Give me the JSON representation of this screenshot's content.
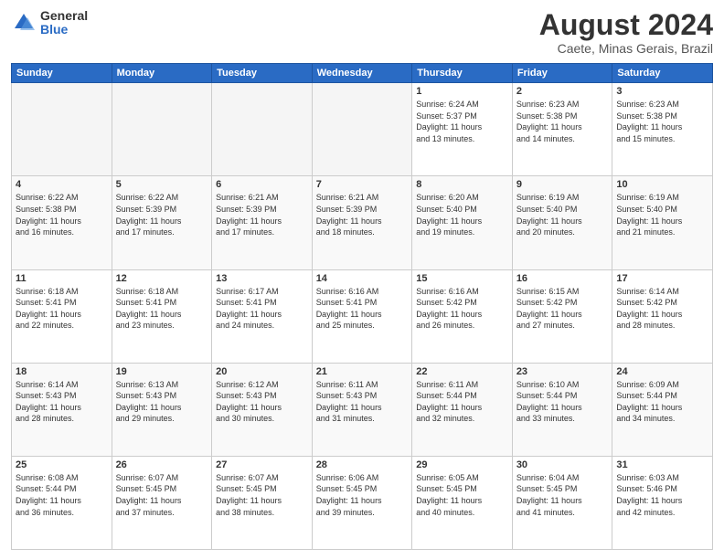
{
  "header": {
    "logo": {
      "general": "General",
      "blue": "Blue"
    },
    "title": "August 2024",
    "subtitle": "Caete, Minas Gerais, Brazil"
  },
  "calendar": {
    "days_of_week": [
      "Sunday",
      "Monday",
      "Tuesday",
      "Wednesday",
      "Thursday",
      "Friday",
      "Saturday"
    ],
    "weeks": [
      [
        {
          "day": "",
          "info": ""
        },
        {
          "day": "",
          "info": ""
        },
        {
          "day": "",
          "info": ""
        },
        {
          "day": "",
          "info": ""
        },
        {
          "day": "1",
          "info": "Sunrise: 6:24 AM\nSunset: 5:37 PM\nDaylight: 11 hours\nand 13 minutes."
        },
        {
          "day": "2",
          "info": "Sunrise: 6:23 AM\nSunset: 5:38 PM\nDaylight: 11 hours\nand 14 minutes."
        },
        {
          "day": "3",
          "info": "Sunrise: 6:23 AM\nSunset: 5:38 PM\nDaylight: 11 hours\nand 15 minutes."
        }
      ],
      [
        {
          "day": "4",
          "info": "Sunrise: 6:22 AM\nSunset: 5:38 PM\nDaylight: 11 hours\nand 16 minutes."
        },
        {
          "day": "5",
          "info": "Sunrise: 6:22 AM\nSunset: 5:39 PM\nDaylight: 11 hours\nand 17 minutes."
        },
        {
          "day": "6",
          "info": "Sunrise: 6:21 AM\nSunset: 5:39 PM\nDaylight: 11 hours\nand 17 minutes."
        },
        {
          "day": "7",
          "info": "Sunrise: 6:21 AM\nSunset: 5:39 PM\nDaylight: 11 hours\nand 18 minutes."
        },
        {
          "day": "8",
          "info": "Sunrise: 6:20 AM\nSunset: 5:40 PM\nDaylight: 11 hours\nand 19 minutes."
        },
        {
          "day": "9",
          "info": "Sunrise: 6:19 AM\nSunset: 5:40 PM\nDaylight: 11 hours\nand 20 minutes."
        },
        {
          "day": "10",
          "info": "Sunrise: 6:19 AM\nSunset: 5:40 PM\nDaylight: 11 hours\nand 21 minutes."
        }
      ],
      [
        {
          "day": "11",
          "info": "Sunrise: 6:18 AM\nSunset: 5:41 PM\nDaylight: 11 hours\nand 22 minutes."
        },
        {
          "day": "12",
          "info": "Sunrise: 6:18 AM\nSunset: 5:41 PM\nDaylight: 11 hours\nand 23 minutes."
        },
        {
          "day": "13",
          "info": "Sunrise: 6:17 AM\nSunset: 5:41 PM\nDaylight: 11 hours\nand 24 minutes."
        },
        {
          "day": "14",
          "info": "Sunrise: 6:16 AM\nSunset: 5:41 PM\nDaylight: 11 hours\nand 25 minutes."
        },
        {
          "day": "15",
          "info": "Sunrise: 6:16 AM\nSunset: 5:42 PM\nDaylight: 11 hours\nand 26 minutes."
        },
        {
          "day": "16",
          "info": "Sunrise: 6:15 AM\nSunset: 5:42 PM\nDaylight: 11 hours\nand 27 minutes."
        },
        {
          "day": "17",
          "info": "Sunrise: 6:14 AM\nSunset: 5:42 PM\nDaylight: 11 hours\nand 28 minutes."
        }
      ],
      [
        {
          "day": "18",
          "info": "Sunrise: 6:14 AM\nSunset: 5:43 PM\nDaylight: 11 hours\nand 28 minutes."
        },
        {
          "day": "19",
          "info": "Sunrise: 6:13 AM\nSunset: 5:43 PM\nDaylight: 11 hours\nand 29 minutes."
        },
        {
          "day": "20",
          "info": "Sunrise: 6:12 AM\nSunset: 5:43 PM\nDaylight: 11 hours\nand 30 minutes."
        },
        {
          "day": "21",
          "info": "Sunrise: 6:11 AM\nSunset: 5:43 PM\nDaylight: 11 hours\nand 31 minutes."
        },
        {
          "day": "22",
          "info": "Sunrise: 6:11 AM\nSunset: 5:44 PM\nDaylight: 11 hours\nand 32 minutes."
        },
        {
          "day": "23",
          "info": "Sunrise: 6:10 AM\nSunset: 5:44 PM\nDaylight: 11 hours\nand 33 minutes."
        },
        {
          "day": "24",
          "info": "Sunrise: 6:09 AM\nSunset: 5:44 PM\nDaylight: 11 hours\nand 34 minutes."
        }
      ],
      [
        {
          "day": "25",
          "info": "Sunrise: 6:08 AM\nSunset: 5:44 PM\nDaylight: 11 hours\nand 36 minutes."
        },
        {
          "day": "26",
          "info": "Sunrise: 6:07 AM\nSunset: 5:45 PM\nDaylight: 11 hours\nand 37 minutes."
        },
        {
          "day": "27",
          "info": "Sunrise: 6:07 AM\nSunset: 5:45 PM\nDaylight: 11 hours\nand 38 minutes."
        },
        {
          "day": "28",
          "info": "Sunrise: 6:06 AM\nSunset: 5:45 PM\nDaylight: 11 hours\nand 39 minutes."
        },
        {
          "day": "29",
          "info": "Sunrise: 6:05 AM\nSunset: 5:45 PM\nDaylight: 11 hours\nand 40 minutes."
        },
        {
          "day": "30",
          "info": "Sunrise: 6:04 AM\nSunset: 5:45 PM\nDaylight: 11 hours\nand 41 minutes."
        },
        {
          "day": "31",
          "info": "Sunrise: 6:03 AM\nSunset: 5:46 PM\nDaylight: 11 hours\nand 42 minutes."
        }
      ]
    ]
  }
}
